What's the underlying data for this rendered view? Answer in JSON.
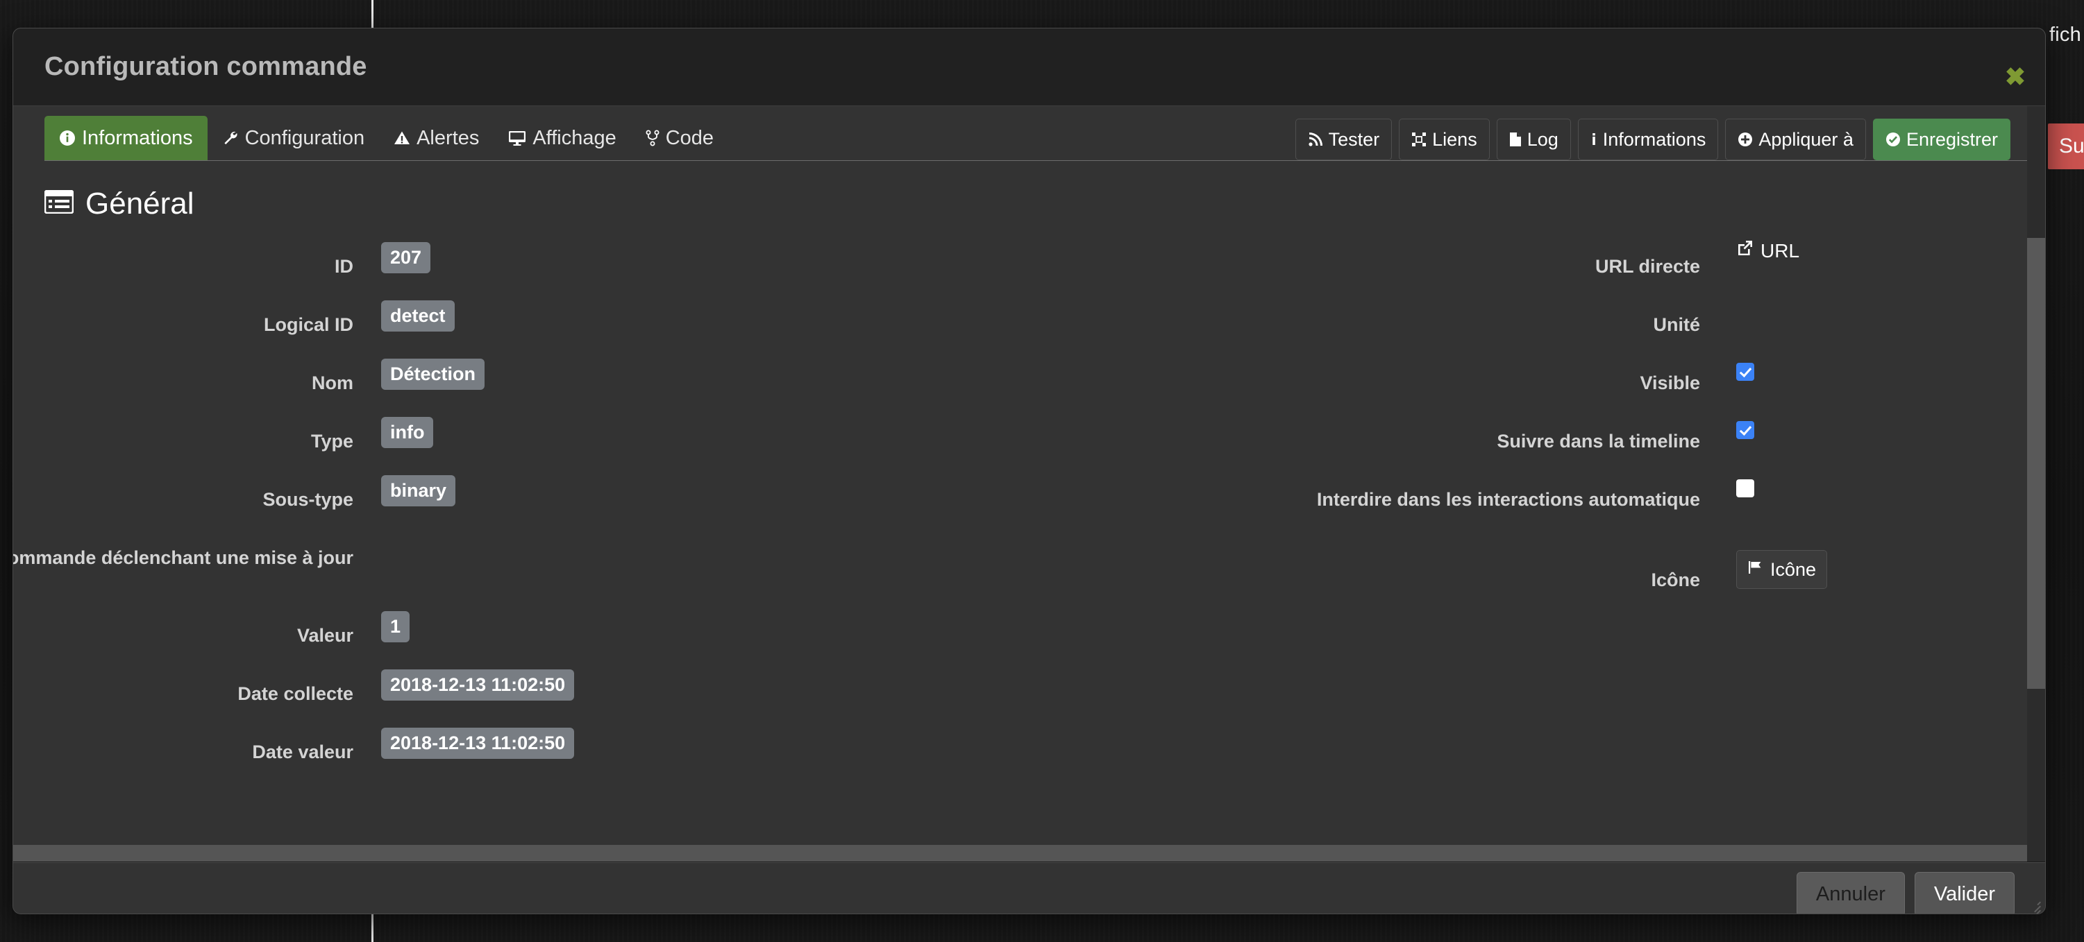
{
  "background": {
    "right_text": "fich",
    "delete_button_label": "Sup"
  },
  "modal": {
    "title": "Configuration commande",
    "close_label": "✖"
  },
  "tabs": [
    {
      "label": "Informations",
      "icon": "info-circle-icon",
      "active": true
    },
    {
      "label": "Configuration",
      "icon": "wrench-icon",
      "active": false
    },
    {
      "label": "Alertes",
      "icon": "warning-triangle-icon",
      "active": false
    },
    {
      "label": "Affichage",
      "icon": "desktop-icon",
      "active": false
    },
    {
      "label": "Code",
      "icon": "code-branch-icon",
      "active": false
    }
  ],
  "actions": [
    {
      "label": "Tester",
      "icon": "rss-icon",
      "style": "default"
    },
    {
      "label": "Liens",
      "icon": "link-diagram-icon",
      "style": "default"
    },
    {
      "label": "Log",
      "icon": "file-icon",
      "style": "default"
    },
    {
      "label": "Informations",
      "icon": "info-icon",
      "style": "default"
    },
    {
      "label": "Appliquer à",
      "icon": "plus-circle-icon",
      "style": "default"
    },
    {
      "label": "Enregistrer",
      "icon": "check-circle-icon",
      "style": "success"
    }
  ],
  "section": {
    "title": "Général",
    "icon": "list-table-icon"
  },
  "form": {
    "left": [
      {
        "label": "ID",
        "value": "207",
        "type": "badge"
      },
      {
        "label": "Logical ID",
        "value": "detect",
        "type": "badge"
      },
      {
        "label": "Nom",
        "value": "Détection",
        "type": "badge"
      },
      {
        "label": "Type",
        "value": "info",
        "type": "badge"
      },
      {
        "label": "Sous-type",
        "value": "binary",
        "type": "badge"
      },
      {
        "label": "Commande déclenchant une mise à jour",
        "value": "",
        "type": "empty"
      },
      {
        "label": "Valeur",
        "value": "1",
        "type": "badge"
      },
      {
        "label": "Date collecte",
        "value": "2018-12-13 11:02:50",
        "type": "badge"
      },
      {
        "label": "Date valeur",
        "value": "2018-12-13 11:02:50",
        "type": "badge"
      }
    ],
    "right": [
      {
        "label": "URL directe",
        "value": "URL",
        "type": "link",
        "icon": "external-link-icon"
      },
      {
        "label": "Unité",
        "value": "",
        "type": "empty"
      },
      {
        "label": "Visible",
        "value": "checked",
        "type": "checkbox"
      },
      {
        "label": "Suivre dans la timeline",
        "value": "checked",
        "type": "checkbox"
      },
      {
        "label": "Interdire dans les interactions automatique",
        "value": "unchecked",
        "type": "checkbox"
      },
      {
        "label": "Icône",
        "value": "Icône",
        "type": "icon-button",
        "icon": "flag-icon"
      }
    ]
  },
  "footer": {
    "cancel_label": "Annuler",
    "validate_label": "Valider"
  },
  "colors": {
    "modal_bg": "#333333",
    "header_bg": "#212121",
    "accent_green": "#4f7f38",
    "save_green": "#4b8a4f",
    "badge_gray": "#787d83",
    "checkbox_blue": "#3b82f6",
    "close_x": "#7f9a33",
    "danger_red": "#c9524f"
  }
}
